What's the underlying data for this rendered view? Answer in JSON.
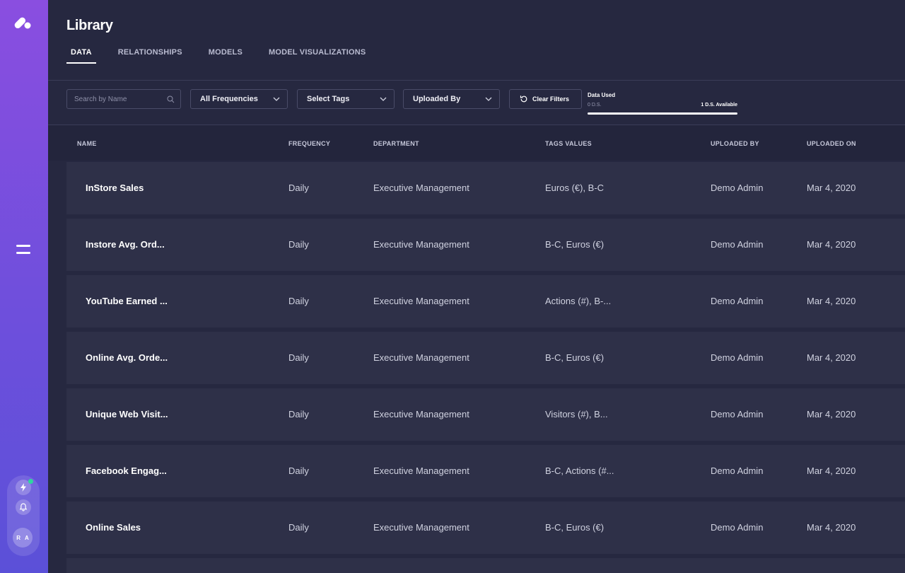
{
  "header": {
    "title": "Library",
    "tabs": [
      {
        "label": "DATA",
        "active": true
      },
      {
        "label": "RELATIONSHIPS",
        "active": false
      },
      {
        "label": "MODELS",
        "active": false
      },
      {
        "label": "MODEL VISUALIZATIONS",
        "active": false
      }
    ]
  },
  "filters": {
    "search_placeholder": "Search by Name",
    "frequency_label": "All Frequencies",
    "tags_label": "Select Tags",
    "uploaded_by_label": "Uploaded By",
    "clear_label": "Clear Filters"
  },
  "data_usage": {
    "title": "Data Used",
    "used": "0 D.S.",
    "available": "1 D.S. Available"
  },
  "user": {
    "initials": "R A"
  },
  "colors": {
    "accent": "#8a4ee0",
    "background": "#262840",
    "row": "#2e3048",
    "online": "#2fd6a0"
  },
  "table": {
    "columns": [
      "NAME",
      "FREQUENCY",
      "DEPARTMENT",
      "TAGS VALUES",
      "UPLOADED BY",
      "UPLOADED ON"
    ],
    "rows": [
      {
        "name": "InStore Sales",
        "frequency": "Daily",
        "department": "Executive Management",
        "tags": "Euros (€), B-C",
        "uploaded_by": "Demo Admin",
        "uploaded_on": "Mar 4, 2020"
      },
      {
        "name": "Instore Avg. Ord...",
        "frequency": "Daily",
        "department": "Executive Management",
        "tags": "B-C, Euros (€)",
        "uploaded_by": "Demo Admin",
        "uploaded_on": "Mar 4, 2020"
      },
      {
        "name": "YouTube Earned ...",
        "frequency": "Daily",
        "department": "Executive Management",
        "tags": "Actions (#), B-...",
        "uploaded_by": "Demo Admin",
        "uploaded_on": "Mar 4, 2020"
      },
      {
        "name": "Online Avg. Orde...",
        "frequency": "Daily",
        "department": "Executive Management",
        "tags": "B-C, Euros (€)",
        "uploaded_by": "Demo Admin",
        "uploaded_on": "Mar 4, 2020"
      },
      {
        "name": "Unique Web Visit...",
        "frequency": "Daily",
        "department": "Executive Management",
        "tags": "Visitors (#), B...",
        "uploaded_by": "Demo Admin",
        "uploaded_on": "Mar 4, 2020"
      },
      {
        "name": "Facebook Engag...",
        "frequency": "Daily",
        "department": "Executive Management",
        "tags": "B-C, Actions (#...",
        "uploaded_by": "Demo Admin",
        "uploaded_on": "Mar 4, 2020"
      },
      {
        "name": "Online Sales",
        "frequency": "Daily",
        "department": "Executive Management",
        "tags": "B-C, Euros (€)",
        "uploaded_by": "Demo Admin",
        "uploaded_on": "Mar 4, 2020"
      }
    ]
  }
}
